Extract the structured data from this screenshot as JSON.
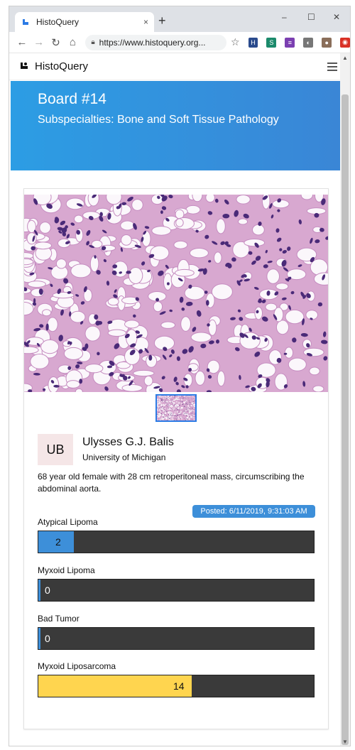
{
  "browser": {
    "tab_title": "HistoQuery",
    "tab_close": "×",
    "new_tab": "+",
    "url": "https://www.histoquery.org...",
    "window_controls": [
      "–",
      "☐",
      "✕"
    ],
    "extensions": [
      {
        "name": "h-extension-icon",
        "label": "H",
        "color": "#2a4b8d"
      },
      {
        "name": "s-extension-icon",
        "label": "S",
        "color": "#1b8a6b"
      },
      {
        "name": "purple-extension-icon",
        "label": "≡",
        "color": "#7b3fb1"
      },
      {
        "name": "circle-extension-icon",
        "label": "◐",
        "color": "#777777"
      },
      {
        "name": "profile-avatar-icon",
        "label": "●",
        "color": "#8a6e5a"
      },
      {
        "name": "red-extension-icon",
        "label": "◉",
        "color": "#d93025"
      }
    ]
  },
  "app": {
    "brand": "HistoQuery"
  },
  "banner": {
    "board": "Board #14",
    "subspecialties": "Subspecialties: Bone and Soft Tissue Pathology"
  },
  "post": {
    "avatar_initials": "UB",
    "author": "Ulysses G.J. Balis",
    "affiliation": "University of Michigan",
    "description": "68 year old female with 28 cm retroperitoneal mass, circumscribing the abdominal aorta.",
    "posted": "Posted: 6/11/2019, 9:31:03 AM"
  },
  "votes": [
    {
      "label": "Atypical Lipoma",
      "count": "2",
      "fraction": 0.1282,
      "color": "#3d8fd9"
    },
    {
      "label": "Myxoid Lipoma",
      "count": "0",
      "fraction": 0.0,
      "color": "#3d8fd9"
    },
    {
      "label": "Bad Tumor",
      "count": "0",
      "fraction": 0.0,
      "color": "#3d8fd9"
    },
    {
      "label": "Myxoid Liposarcoma",
      "count": "14",
      "fraction": 0.5538,
      "color": "#ffd54f"
    }
  ],
  "colors": {
    "banner": "#2c9de4",
    "accent": "#3d8fd9",
    "highlight": "#ffd54f",
    "bar_background": "#3a3a3a"
  }
}
